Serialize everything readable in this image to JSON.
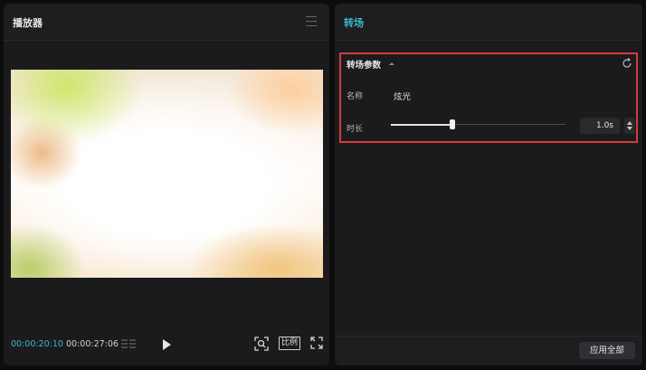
{
  "player": {
    "title": "播放器",
    "current_time": "00:00:20:10",
    "total_time": "00:00:27:06",
    "ratio_label": "比例"
  },
  "transition": {
    "title": "转场",
    "params_title": "转场参数",
    "name_label": "名称",
    "name_value": "炫光",
    "duration_label": "时长",
    "duration_value": "1.0s",
    "duration_slider_fraction": 0.35,
    "apply_all_label": "应用全部"
  },
  "colors": {
    "accent": "#3cb8c8",
    "highlight_border": "#d23b3f"
  }
}
